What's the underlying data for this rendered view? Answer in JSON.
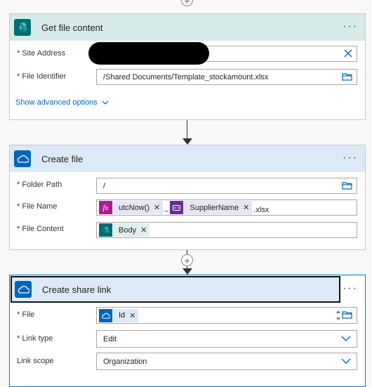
{
  "colors": {
    "sharepoint_header": "#d7eaea",
    "onedrive_header": "#dceaf7",
    "sharepoint_icon": "#036c70",
    "onedrive_icon": "#0364b8",
    "expression_token": "#aa1e8c",
    "dynamic_token_purple": "#6b2c91",
    "link_blue": "#0067b8"
  },
  "card1": {
    "title": "Get file content",
    "icon": "sharepoint-icon",
    "site_address_label": "Site Address",
    "file_identifier_label": "File Identifier",
    "file_identifier_value": "/Shared Documents/Template_stockamount.xlsx",
    "advanced_label": "Show advanced options"
  },
  "card2": {
    "title": "Create file",
    "icon": "onedrive-icon",
    "folder_path_label": "Folder Path",
    "folder_path_value": "/",
    "file_name_label": "File Name",
    "token_utcnow": "utcNow()",
    "separator": "_",
    "token_supplier": "SupplierName",
    "suffix": ".xlsx",
    "file_content_label": "File Content",
    "token_body": "Body"
  },
  "card3": {
    "title": "Create share link",
    "icon": "onedrive-icon",
    "file_label": "File",
    "token_id": "Id",
    "link_type_label": "Link type",
    "link_type_value": "Edit",
    "link_scope_label": "Link scope",
    "link_scope_value": "Organization"
  },
  "more_label": "···"
}
